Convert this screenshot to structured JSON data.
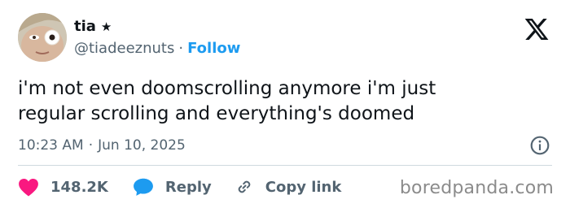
{
  "user": {
    "display_name": "tia",
    "badge_glyph": "★",
    "handle": "@tiadeeznuts",
    "separator": "·",
    "follow_label": "Follow"
  },
  "tweet": {
    "lines": [
      "i'm not even doomscrolling anymore i'm just",
      "regular scrolling and everything's doomed"
    ],
    "time": "10:23 AM",
    "time_separator": "·",
    "date": "Jun 10, 2025"
  },
  "actions": {
    "likes": "148.2K",
    "reply_label": "Reply",
    "copy_link_label": "Copy link"
  },
  "watermark": "boredpanda.com",
  "icons": {
    "logo": "x-logo-icon",
    "info": "info-icon",
    "like": "heart-icon",
    "reply": "speech-bubble-icon",
    "copy": "link-icon"
  },
  "colors": {
    "accent": "#1d9bf0",
    "like": "#f91880",
    "text": "#0f1419",
    "secondary": "#536471",
    "divider": "#cfd9de"
  }
}
